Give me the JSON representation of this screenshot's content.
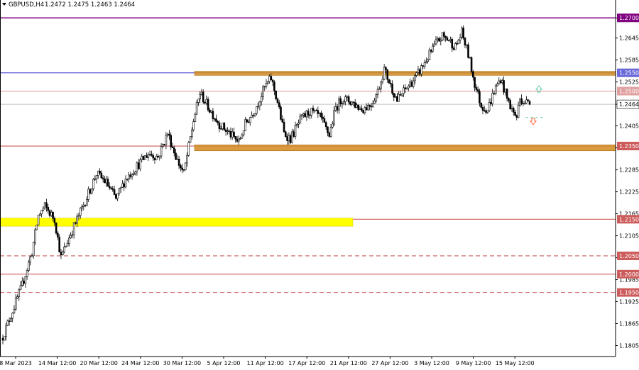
{
  "header": {
    "symbol": "GBPUSD,H4",
    "ohlc": "1.2472 1.2475 1.2463 1.2464",
    "menu_icon": "triangle-down-icon"
  },
  "colors": {
    "background": "#ffffff",
    "axis": "#000000",
    "candle": "#000000",
    "purple_level": "#800080",
    "blue_level": "#6a6ad8",
    "red_level": "#cd5c5c",
    "pink_level": "#e0a0a0",
    "orange_zone": "#d2891e",
    "yellow_zone": "#ffff00",
    "current_price_line": "#c0c0c0",
    "arrow_up": "#66cdaa",
    "arrow_down": "#ff6a3d"
  },
  "chart_data": {
    "type": "candlestick",
    "symbol": "GBPUSD",
    "timeframe": "H4",
    "ylim": [
      1.1775,
      1.2745
    ],
    "y_ticks": [
      "1.2700",
      "1.2645",
      "1.2585",
      "1.2525",
      "1.2464",
      "1.2405",
      "1.2345",
      "1.2285",
      "1.2225",
      "1.2165",
      "1.2105",
      "1.2045",
      "1.1985",
      "1.1925",
      "1.1865",
      "1.1805"
    ],
    "x_labels": [
      "8 Mar 2023",
      "14 Mar 12:00",
      "20 Mar 12:00",
      "24 Mar 12:00",
      "30 Mar 12:00",
      "5 Apr 12:00",
      "11 Apr 12:00",
      "17 Apr 12:00",
      "21 Apr 12:00",
      "27 Apr 12:00",
      "3 May 12:00",
      "9 May 12:00",
      "15 May 12:00"
    ],
    "current_price": "1.2464",
    "levels": [
      {
        "price": 1.27,
        "label": "1.2700",
        "style": "solid",
        "color": "purple"
      },
      {
        "price": 1.255,
        "label": "1.2550",
        "style": "solid",
        "color": "blue"
      },
      {
        "price": 1.25,
        "label": "1.2500",
        "style": "solid",
        "color": "pink"
      },
      {
        "price": 1.235,
        "label": "1.2350",
        "style": "solid",
        "color": "red"
      },
      {
        "price": 1.215,
        "label": "1.2150",
        "style": "solid",
        "color": "red"
      },
      {
        "price": 1.205,
        "label": "1.2050",
        "style": "dashed",
        "color": "red"
      },
      {
        "price": 1.2,
        "label": "1.2000",
        "style": "solid",
        "color": "red"
      },
      {
        "price": 1.195,
        "label": "1.1950",
        "style": "dashed",
        "color": "red"
      }
    ],
    "zones": [
      {
        "name": "resistance-zone",
        "from_date": "2 Apr",
        "low": 1.2543,
        "high": 1.2554,
        "color": "orange"
      },
      {
        "name": "support-zone",
        "from_date": "2 Apr",
        "low": 1.2337,
        "high": 1.2353,
        "color": "orange"
      },
      {
        "name": "yellow-zone",
        "from_date": "8 Mar",
        "to_date": "28 Apr",
        "low": 1.2131,
        "high": 1.2153,
        "color": "yellow"
      }
    ],
    "signals": [
      {
        "type": "up-arrow",
        "price": 1.2505,
        "color": "green"
      },
      {
        "type": "down-arrow",
        "price": 1.2418,
        "color": "orange"
      }
    ],
    "close_path": [
      [
        0,
        1.183
      ],
      [
        6,
        1.19
      ],
      [
        12,
        1.197
      ],
      [
        18,
        1.206
      ],
      [
        22,
        1.216
      ],
      [
        26,
        1.2185
      ],
      [
        32,
        1.215
      ],
      [
        36,
        1.2045
      ],
      [
        40,
        1.209
      ],
      [
        46,
        1.215
      ],
      [
        52,
        1.221
      ],
      [
        58,
        1.2275
      ],
      [
        64,
        1.225
      ],
      [
        70,
        1.2205
      ],
      [
        76,
        1.226
      ],
      [
        84,
        1.23
      ],
      [
        90,
        1.233
      ],
      [
        96,
        1.232
      ],
      [
        102,
        1.2385
      ],
      [
        108,
        1.231
      ],
      [
        112,
        1.2275
      ],
      [
        118,
        1.242
      ],
      [
        122,
        1.2495
      ],
      [
        128,
        1.245
      ],
      [
        134,
        1.241
      ],
      [
        140,
        1.2385
      ],
      [
        146,
        1.236
      ],
      [
        150,
        1.241
      ],
      [
        156,
        1.245
      ],
      [
        162,
        1.251
      ],
      [
        166,
        1.2535
      ],
      [
        170,
        1.247
      ],
      [
        174,
        1.2385
      ],
      [
        178,
        1.237
      ],
      [
        184,
        1.242
      ],
      [
        190,
        1.2445
      ],
      [
        196,
        1.243
      ],
      [
        202,
        1.238
      ],
      [
        206,
        1.2455
      ],
      [
        210,
        1.248
      ],
      [
        216,
        1.247
      ],
      [
        222,
        1.245
      ],
      [
        228,
        1.2465
      ],
      [
        232,
        1.25
      ],
      [
        236,
        1.256
      ],
      [
        240,
        1.2515
      ],
      [
        244,
        1.2475
      ],
      [
        250,
        1.251
      ],
      [
        256,
        1.254
      ],
      [
        262,
        1.2585
      ],
      [
        268,
        1.263
      ],
      [
        272,
        1.265
      ],
      [
        276,
        1.264
      ],
      [
        280,
        1.262
      ],
      [
        284,
        1.266
      ],
      [
        288,
        1.26
      ],
      [
        292,
        1.252
      ],
      [
        296,
        1.246
      ],
      [
        300,
        1.245
      ],
      [
        304,
        1.25
      ],
      [
        308,
        1.2535
      ],
      [
        312,
        1.248
      ],
      [
        316,
        1.244
      ],
      [
        318,
        1.243
      ],
      [
        320,
        1.248
      ],
      [
        324,
        1.247
      ],
      [
        326,
        1.2464
      ]
    ]
  }
}
